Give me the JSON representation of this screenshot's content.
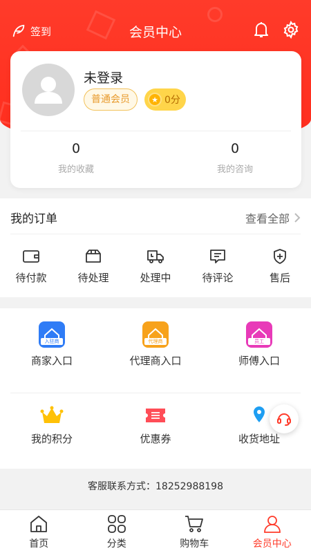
{
  "header": {
    "title": "会员中心",
    "signin_label": "签到",
    "accent_color": "#ff3b2a"
  },
  "profile": {
    "name": "未登录",
    "level": "普通会员",
    "points": "0分",
    "stats": [
      {
        "value": "0",
        "label": "我的收藏"
      },
      {
        "value": "0",
        "label": "我的咨询"
      }
    ]
  },
  "orders": {
    "title": "我的订单",
    "view_all": "查看全部",
    "items": [
      {
        "label": "待付款",
        "icon": "wallet-icon"
      },
      {
        "label": "待处理",
        "icon": "box-icon"
      },
      {
        "label": "处理中",
        "icon": "truck-icon"
      },
      {
        "label": "待评论",
        "icon": "comment-icon"
      },
      {
        "label": "售后",
        "icon": "shield-plus-icon"
      }
    ]
  },
  "entries": {
    "row1": [
      {
        "label": "商家入口",
        "tag": "入驻商",
        "color": "#2f7cf6"
      },
      {
        "label": "代理商入口",
        "tag": "代理商",
        "color": "#f7a21b"
      },
      {
        "label": "师傅入口",
        "tag": "员工",
        "color": "#e83ab8"
      }
    ],
    "row2": [
      {
        "label": "我的积分",
        "icon": "crown-icon"
      },
      {
        "label": "优惠券",
        "icon": "coupon-icon"
      },
      {
        "label": "收货地址",
        "icon": "location-icon"
      }
    ]
  },
  "service": {
    "text": "客服联系方式：18252988198"
  },
  "tabbar": {
    "items": [
      {
        "label": "首页",
        "icon": "home-icon"
      },
      {
        "label": "分类",
        "icon": "category-icon"
      },
      {
        "label": "购物车",
        "icon": "cart-icon"
      },
      {
        "label": "会员中心",
        "icon": "user-icon"
      }
    ]
  }
}
